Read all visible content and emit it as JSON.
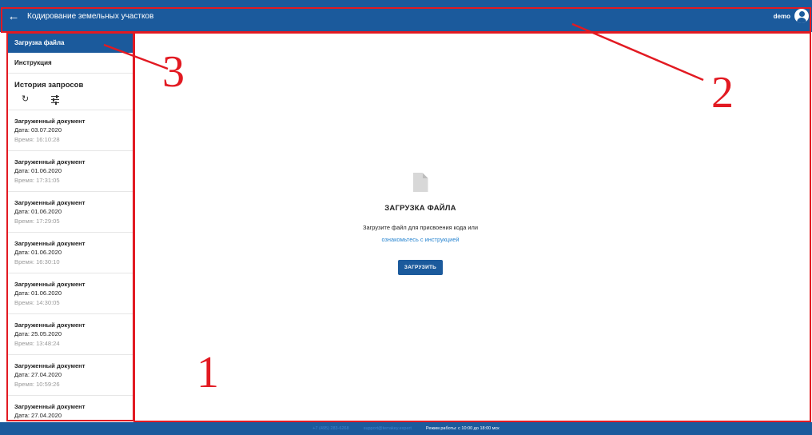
{
  "header": {
    "title": "Кодирование земельных участков",
    "back_icon": "arrow-left-icon",
    "user": "demo",
    "avatar_icon": "account-circle-icon"
  },
  "sidebar": {
    "nav": [
      {
        "label": "Загрузка файла",
        "active": true
      },
      {
        "label": "Инструкция",
        "active": false
      }
    ],
    "history_title": "История запросов",
    "tools": [
      "refresh-icon",
      "tune-filter-icon"
    ],
    "documents": [
      {
        "name": "Загруженный документ",
        "date": "Дата: 03.07.2020",
        "time": "Время: 16:10:28"
      },
      {
        "name": "Загруженный документ",
        "date": "Дата: 01.06.2020",
        "time": "Время: 17:31:05"
      },
      {
        "name": "Загруженный документ",
        "date": "Дата: 01.06.2020",
        "time": "Время: 17:29:05"
      },
      {
        "name": "Загруженный документ",
        "date": "Дата: 01.06.2020",
        "time": "Время: 16:30:10"
      },
      {
        "name": "Загруженный документ",
        "date": "Дата: 01.06.2020",
        "time": "Время: 14:30:05"
      },
      {
        "name": "Загруженный документ",
        "date": "Дата: 25.05.2020",
        "time": "Время: 13:48:24"
      },
      {
        "name": "Загруженный документ",
        "date": "Дата: 27.04.2020",
        "time": "Время: 10:59:26"
      },
      {
        "name": "Загруженный документ",
        "date": "Дата: 27.04.2020",
        "time": ""
      }
    ]
  },
  "main": {
    "file_icon": "file-icon",
    "title": "ЗАГРУЗКА ФАЙЛА",
    "text": "Загрузите файл для присвоения кода или",
    "link": "ознакомьтесь с инструкцией",
    "button": "ЗАГРУЗИТЬ"
  },
  "footer": {
    "phone": "+7 (495) 283-6268",
    "email": "support@terrakey.expert",
    "hours": "Режим работы: с 10:00 до 18:00 мск"
  },
  "annotations": [
    "1",
    "2",
    "3"
  ],
  "colors": {
    "primary": "#1b5a9c",
    "annotation": "#e21a22",
    "link": "#2a86d1"
  }
}
